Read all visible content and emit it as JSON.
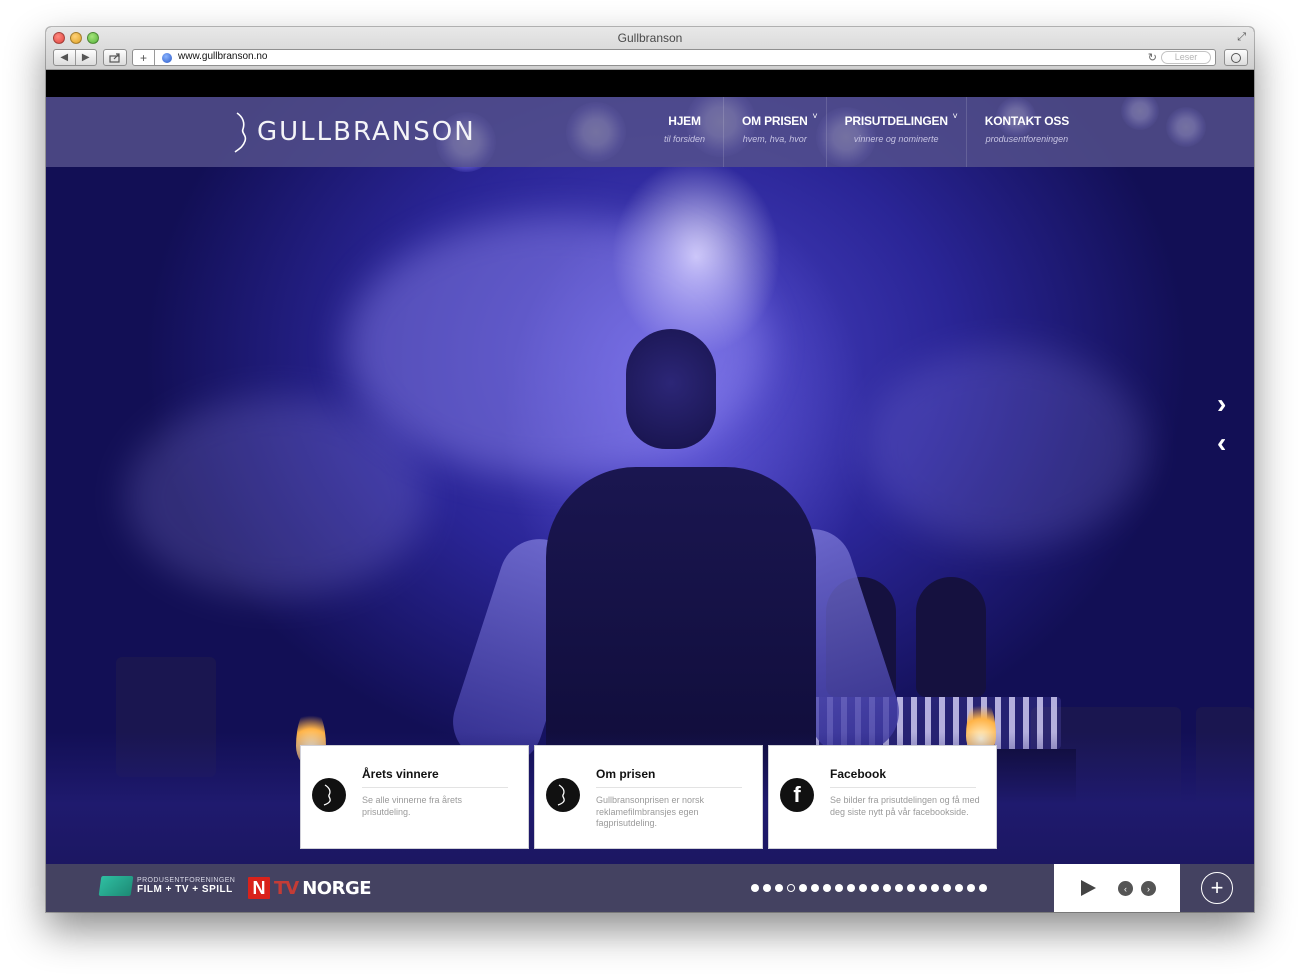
{
  "window": {
    "title": "Gullbranson"
  },
  "browser": {
    "url": "www.gullbranson.no",
    "reader_label": "Leser"
  },
  "site": {
    "logo_text": "GULLBRANSON",
    "nav": [
      {
        "label": "HJEM",
        "sub": "til forsiden",
        "caret": false
      },
      {
        "label": "OM PRISEN",
        "sub": "hvem, hva, hvor",
        "caret": true
      },
      {
        "label": "PRISUTDELINGEN",
        "sub": "vinnere og nominerte",
        "caret": true
      },
      {
        "label": "KONTAKT OSS",
        "sub": "produsentforeningen",
        "caret": false
      }
    ],
    "cards": [
      {
        "title": "Årets vinnere",
        "text": "Se alle vinnerne fra årets prisutdeling.",
        "icon": "gullbranson-mark-icon"
      },
      {
        "title": "Om prisen",
        "text": "Gullbransonprisen er norsk reklamefilmbransjes egen fagprisutdeling.",
        "icon": "gullbranson-mark-icon"
      },
      {
        "title": "Facebook",
        "text": "Se bilder fra prisutdelingen og få med deg siste nytt på vår facebookside.",
        "icon": "facebook-icon"
      }
    ],
    "footer": {
      "pf_small": "PRODUSENTFORENINGEN",
      "pf_big": "FILM + TV + SPILL",
      "tvn_letter": "N",
      "tvn_tv": "TV",
      "tvn_word": "NORGE",
      "slide_count": 20,
      "active_slide": 4
    }
  },
  "colors": {
    "header_overlay": "#56528c",
    "footer_bar": "#484662",
    "hero_blue": "#2a2596"
  }
}
